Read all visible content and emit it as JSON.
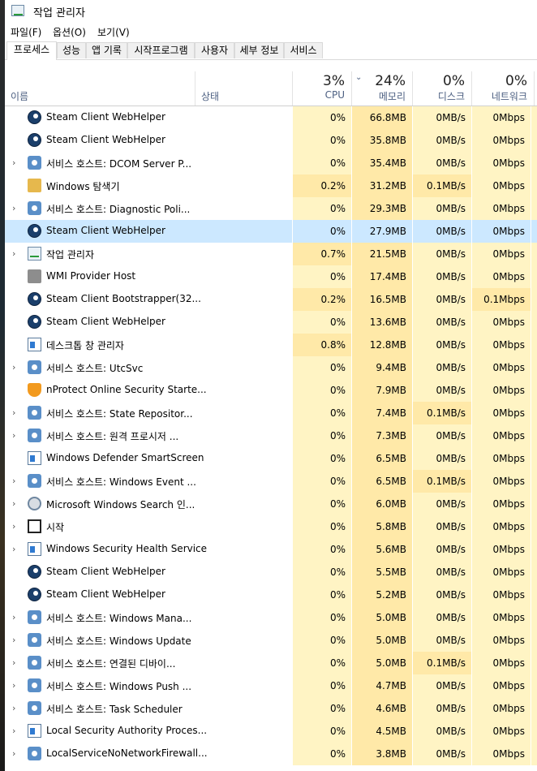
{
  "window": {
    "title": "작업 관리자"
  },
  "menu": {
    "file": "파일(F)",
    "options": "옵션(O)",
    "view": "보기(V)"
  },
  "tabs": [
    "프로세스",
    "성능",
    "앱 기록",
    "시작프로그램",
    "사용자",
    "세부 정보",
    "서비스"
  ],
  "header": {
    "name": "이름",
    "status": "상태",
    "cpu_pct": "3%",
    "cpu": "CPU",
    "mem_pct": "24%",
    "mem": "메모리",
    "disk_pct": "0%",
    "disk": "디스크",
    "net_pct": "0%",
    "net": "네트워크"
  },
  "colors": {
    "heat_low": "#fff4c4",
    "heat_mid": "#ffe9a8",
    "selected": "#cce8ff",
    "header_text": "#4d6082"
  },
  "rows": [
    {
      "name": "Steam Client WebHelper",
      "icon": "steam-icon",
      "expand": false,
      "cpu": "0%",
      "mem": "66.8MB",
      "disk": "0MB/s",
      "net": "0Mbps"
    },
    {
      "name": "Steam Client WebHelper",
      "icon": "steam-icon",
      "expand": false,
      "cpu": "0%",
      "mem": "35.8MB",
      "disk": "0MB/s",
      "net": "0Mbps"
    },
    {
      "name": "서비스 호스트: DCOM Server P...",
      "icon": "gear-icon",
      "expand": true,
      "cpu": "0%",
      "mem": "35.4MB",
      "disk": "0MB/s",
      "net": "0Mbps"
    },
    {
      "name": "Windows 탐색기",
      "icon": "folder-icon",
      "expand": false,
      "cpu": "0.2%",
      "mem": "31.2MB",
      "disk": "0.1MB/s",
      "net": "0Mbps"
    },
    {
      "name": "서비스 호스트: Diagnostic Poli...",
      "icon": "gear-icon",
      "expand": true,
      "cpu": "0%",
      "mem": "29.3MB",
      "disk": "0MB/s",
      "net": "0Mbps"
    },
    {
      "name": "Steam Client WebHelper",
      "icon": "steam-icon",
      "expand": false,
      "cpu": "0%",
      "mem": "27.9MB",
      "disk": "0MB/s",
      "net": "0Mbps",
      "selected": true
    },
    {
      "name": "작업 관리자",
      "icon": "task-manager-icon",
      "expand": true,
      "cpu": "0.7%",
      "mem": "21.5MB",
      "disk": "0MB/s",
      "net": "0Mbps"
    },
    {
      "name": "WMI Provider Host",
      "icon": "wmi-icon",
      "expand": false,
      "cpu": "0%",
      "mem": "17.4MB",
      "disk": "0MB/s",
      "net": "0Mbps"
    },
    {
      "name": "Steam Client Bootstrapper(32...",
      "icon": "steam-icon",
      "expand": false,
      "cpu": "0.2%",
      "mem": "16.5MB",
      "disk": "0MB/s",
      "net": "0.1Mbps"
    },
    {
      "name": "Steam Client WebHelper",
      "icon": "steam-icon",
      "expand": false,
      "cpu": "0%",
      "mem": "13.6MB",
      "disk": "0MB/s",
      "net": "0Mbps"
    },
    {
      "name": "데스크톱 창 관리자",
      "icon": "window-icon",
      "expand": false,
      "cpu": "0.8%",
      "mem": "12.8MB",
      "disk": "0MB/s",
      "net": "0Mbps"
    },
    {
      "name": "서비스 호스트: UtcSvc",
      "icon": "gear-icon",
      "expand": true,
      "cpu": "0%",
      "mem": "9.4MB",
      "disk": "0MB/s",
      "net": "0Mbps"
    },
    {
      "name": "nProtect Online Security Starte...",
      "icon": "shield-icon",
      "expand": false,
      "cpu": "0%",
      "mem": "7.9MB",
      "disk": "0MB/s",
      "net": "0Mbps"
    },
    {
      "name": "서비스 호스트: State Repositor...",
      "icon": "gear-icon",
      "expand": true,
      "cpu": "0%",
      "mem": "7.4MB",
      "disk": "0.1MB/s",
      "net": "0Mbps"
    },
    {
      "name": "서비스 호스트: 원격 프로시저 ...",
      "icon": "gear-icon",
      "expand": true,
      "cpu": "0%",
      "mem": "7.3MB",
      "disk": "0MB/s",
      "net": "0Mbps"
    },
    {
      "name": "Windows Defender SmartScreen",
      "icon": "window-icon",
      "expand": false,
      "cpu": "0%",
      "mem": "6.5MB",
      "disk": "0MB/s",
      "net": "0Mbps"
    },
    {
      "name": "서비스 호스트: Windows Event ...",
      "icon": "gear-icon",
      "expand": true,
      "cpu": "0%",
      "mem": "6.5MB",
      "disk": "0.1MB/s",
      "net": "0Mbps"
    },
    {
      "name": "Microsoft Windows Search 인...",
      "icon": "search-icon",
      "expand": true,
      "cpu": "0%",
      "mem": "6.0MB",
      "disk": "0MB/s",
      "net": "0Mbps"
    },
    {
      "name": "시작",
      "icon": "start-icon",
      "expand": true,
      "cpu": "0%",
      "mem": "5.8MB",
      "disk": "0MB/s",
      "net": "0Mbps"
    },
    {
      "name": "Windows Security Health Service",
      "icon": "window-icon",
      "expand": true,
      "cpu": "0%",
      "mem": "5.6MB",
      "disk": "0MB/s",
      "net": "0Mbps"
    },
    {
      "name": "Steam Client WebHelper",
      "icon": "steam-icon",
      "expand": false,
      "cpu": "0%",
      "mem": "5.5MB",
      "disk": "0MB/s",
      "net": "0Mbps"
    },
    {
      "name": "Steam Client WebHelper",
      "icon": "steam-icon",
      "expand": false,
      "cpu": "0%",
      "mem": "5.2MB",
      "disk": "0MB/s",
      "net": "0Mbps"
    },
    {
      "name": "서비스 호스트: Windows Mana...",
      "icon": "gear-icon",
      "expand": true,
      "cpu": "0%",
      "mem": "5.0MB",
      "disk": "0MB/s",
      "net": "0Mbps"
    },
    {
      "name": "서비스 호스트: Windows Update",
      "icon": "gear-icon",
      "expand": true,
      "cpu": "0%",
      "mem": "5.0MB",
      "disk": "0MB/s",
      "net": "0Mbps"
    },
    {
      "name": "서비스 호스트: 연결된 디바이...",
      "icon": "gear-icon",
      "expand": true,
      "cpu": "0%",
      "mem": "5.0MB",
      "disk": "0.1MB/s",
      "net": "0Mbps"
    },
    {
      "name": "서비스 호스트: Windows Push ...",
      "icon": "gear-icon",
      "expand": true,
      "cpu": "0%",
      "mem": "4.7MB",
      "disk": "0MB/s",
      "net": "0Mbps"
    },
    {
      "name": "서비스 호스트: Task Scheduler",
      "icon": "gear-icon",
      "expand": true,
      "cpu": "0%",
      "mem": "4.6MB",
      "disk": "0MB/s",
      "net": "0Mbps"
    },
    {
      "name": "Local Security Authority Proces...",
      "icon": "window-icon",
      "expand": true,
      "cpu": "0%",
      "mem": "4.5MB",
      "disk": "0MB/s",
      "net": "0Mbps"
    },
    {
      "name": "LocalServiceNoNetworkFirewall...",
      "icon": "gear-icon",
      "expand": true,
      "cpu": "0%",
      "mem": "3.8MB",
      "disk": "0MB/s",
      "net": "0Mbps"
    }
  ]
}
